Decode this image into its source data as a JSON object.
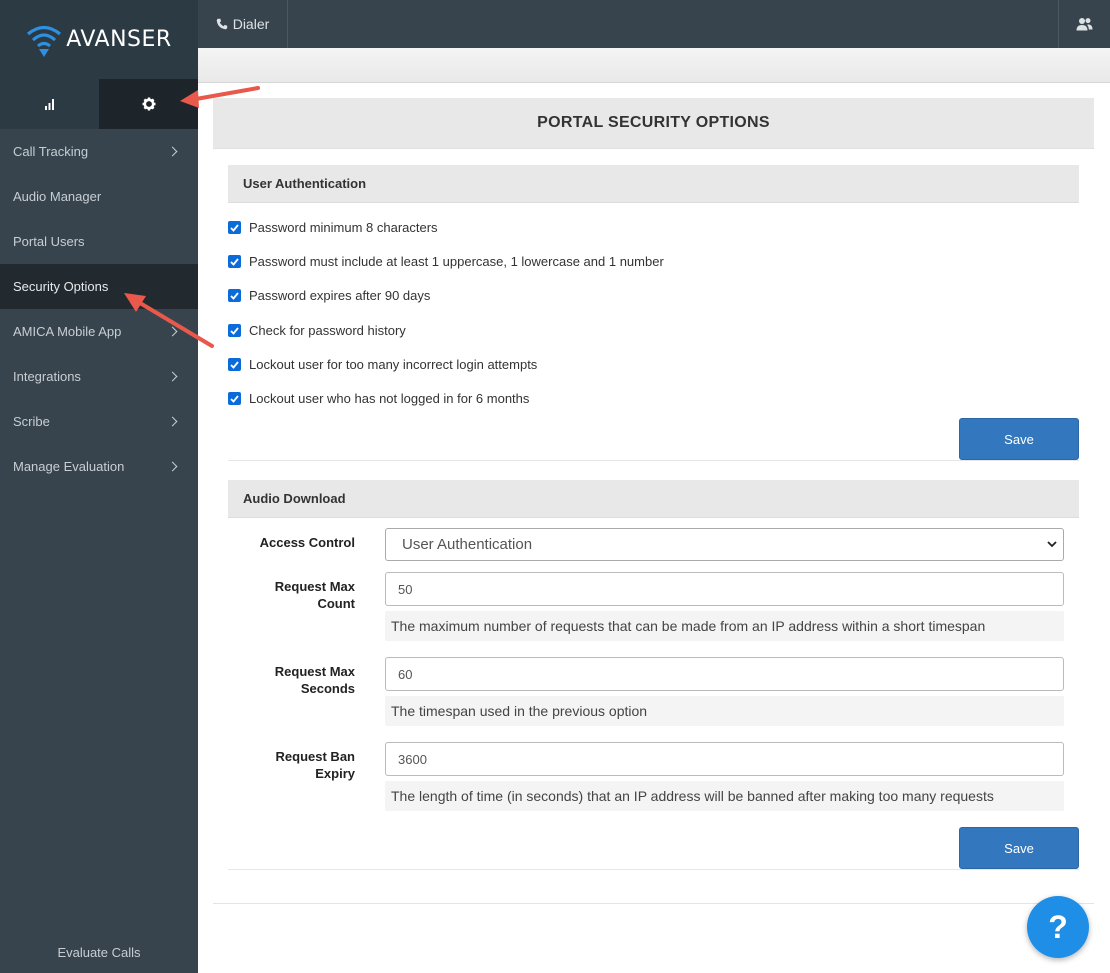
{
  "brand": {
    "name": "AVANSER"
  },
  "topbar": {
    "dialer_label": "Dialer"
  },
  "sidebar": {
    "items": [
      {
        "label": "Call Tracking",
        "has_children": true
      },
      {
        "label": "Audio Manager",
        "has_children": false
      },
      {
        "label": "Portal Users",
        "has_children": false
      },
      {
        "label": "Security Options",
        "has_children": false,
        "active": true
      },
      {
        "label": "AMICA Mobile App",
        "has_children": true
      },
      {
        "label": "Integrations",
        "has_children": true
      },
      {
        "label": "Scribe",
        "has_children": true
      },
      {
        "label": "Manage Evaluation",
        "has_children": true
      }
    ],
    "footer": "Evaluate Calls"
  },
  "page": {
    "title": "PORTAL SECURITY OPTIONS"
  },
  "user_auth": {
    "heading": "User Authentication",
    "options": [
      {
        "label": "Password minimum 8 characters",
        "checked": true
      },
      {
        "label": "Password must include at least 1 uppercase, 1 lowercase and 1 number",
        "checked": true
      },
      {
        "label": "Password expires after 90 days",
        "checked": true
      },
      {
        "label": "Check for password history",
        "checked": true
      },
      {
        "label": "Lockout user for too many incorrect login attempts",
        "checked": true
      },
      {
        "label": "Lockout user who has not logged in for 6 months",
        "checked": true
      }
    ],
    "save_label": "Save"
  },
  "audio_download": {
    "heading": "Audio Download",
    "access_control": {
      "label": "Access Control",
      "value": "User Authentication"
    },
    "request_max_count": {
      "label_line1": "Request Max",
      "label_line2": "Count",
      "value": "50",
      "help": "The maximum number of requests that can be made from an IP address within a short timespan"
    },
    "request_max_seconds": {
      "label_line1": "Request Max",
      "label_line2": "Seconds",
      "value": "60",
      "help": "The timespan used in the previous option"
    },
    "request_ban_expiry": {
      "label_line1": "Request Ban",
      "label_line2": "Expiry",
      "value": "3600",
      "help": "The length of time (in seconds) that an IP address will be banned after making too many requests"
    },
    "save_label": "Save"
  },
  "help_bubble": {
    "label": "?"
  },
  "colors": {
    "sidebar": "#37444e",
    "primary_button": "#3378be",
    "annotation_arrow": "#e8584b",
    "help_bubble": "#1e8ee6"
  },
  "icons": {
    "stats_tab": "bar-chart-icon",
    "settings_tab": "gear-icon",
    "dialer": "phone-icon",
    "user": "users-icon",
    "help": "question-icon"
  }
}
